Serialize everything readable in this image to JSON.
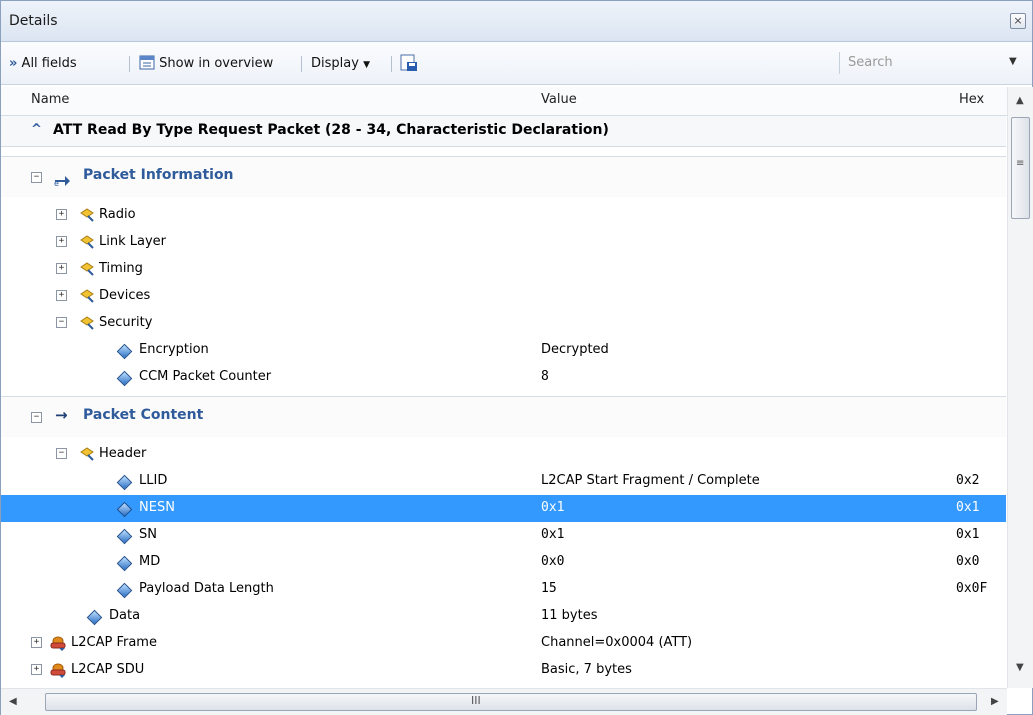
{
  "window": {
    "title": "Details"
  },
  "toolbar": {
    "all_fields": "All fields",
    "show_in_overview": "Show in overview",
    "display": "Display",
    "search_placeholder": "Search"
  },
  "columns": {
    "name": "Name",
    "value": "Value",
    "hex": "Hex"
  },
  "packet_title": "ATT Read By Type Request Packet (28 - 34, Characteristic Declaration)",
  "sections": {
    "packet_information": "Packet Information",
    "packet_content": "Packet Content"
  },
  "info_rows": [
    {
      "name": "Radio",
      "value": "",
      "hex": ""
    },
    {
      "name": "Link Layer",
      "value": "",
      "hex": ""
    },
    {
      "name": "Timing",
      "value": "",
      "hex": ""
    },
    {
      "name": "Devices",
      "value": "",
      "hex": ""
    },
    {
      "name": "Security",
      "value": "",
      "hex": ""
    },
    {
      "name": "Encryption",
      "value": "Decrypted",
      "hex": ""
    },
    {
      "name": "CCM Packet Counter",
      "value": "8",
      "hex": ""
    }
  ],
  "content_rows": [
    {
      "name": "Header",
      "value": "",
      "hex": ""
    },
    {
      "name": "LLID",
      "value": "L2CAP Start Fragment / Complete",
      "hex": "0x2"
    },
    {
      "name": "NESN",
      "value": "0x1",
      "hex": "0x1"
    },
    {
      "name": "SN",
      "value": "0x1",
      "hex": "0x1"
    },
    {
      "name": "MD",
      "value": "0x0",
      "hex": "0x0"
    },
    {
      "name": "Payload Data Length",
      "value": "15",
      "hex": "0x0F"
    },
    {
      "name": "Data",
      "value": "11 bytes",
      "hex": ""
    },
    {
      "name": "L2CAP Frame",
      "value": "Channel=0x0004 (ATT)",
      "hex": ""
    },
    {
      "name": "L2CAP SDU",
      "value": "Basic, 7 bytes",
      "hex": ""
    }
  ],
  "scrollbar": {
    "h_grip": "III",
    "v_grip": "≡"
  }
}
